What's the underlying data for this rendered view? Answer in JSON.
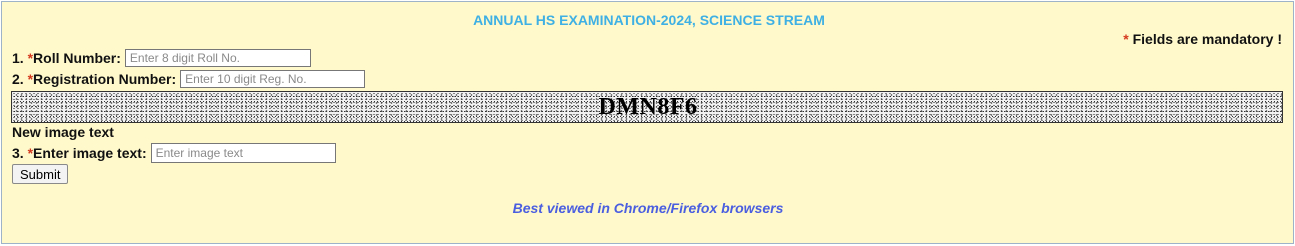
{
  "page": {
    "title": "ANNUAL HS EXAMINATION-2024, SCIENCE STREAM",
    "mandatory_star": "*",
    "mandatory_text": "Fields are mandatory !",
    "footer_note": "Best viewed in Chrome/Firefox browsers"
  },
  "form": {
    "roll": {
      "number": "1.",
      "star": "*",
      "label": "Roll Number:",
      "value": "",
      "placeholder": "Enter 8 digit Roll No."
    },
    "registration": {
      "number": "2.",
      "star": "*",
      "label": "Registration Number:",
      "value": "",
      "placeholder": "Enter 10 digit Reg. No."
    },
    "captcha_image_text": "DMN8F6",
    "new_image_label": "New image text",
    "captcha_input": {
      "number": "3.",
      "star": "*",
      "label": "Enter image text:",
      "value": "",
      "placeholder": "Enter image text"
    },
    "submit_label": "Submit"
  },
  "colors": {
    "panel_background": "#fff9cc",
    "title": "#3fb0e3",
    "required_star": "#d43a1e",
    "footer_note": "#4a5ee0"
  }
}
